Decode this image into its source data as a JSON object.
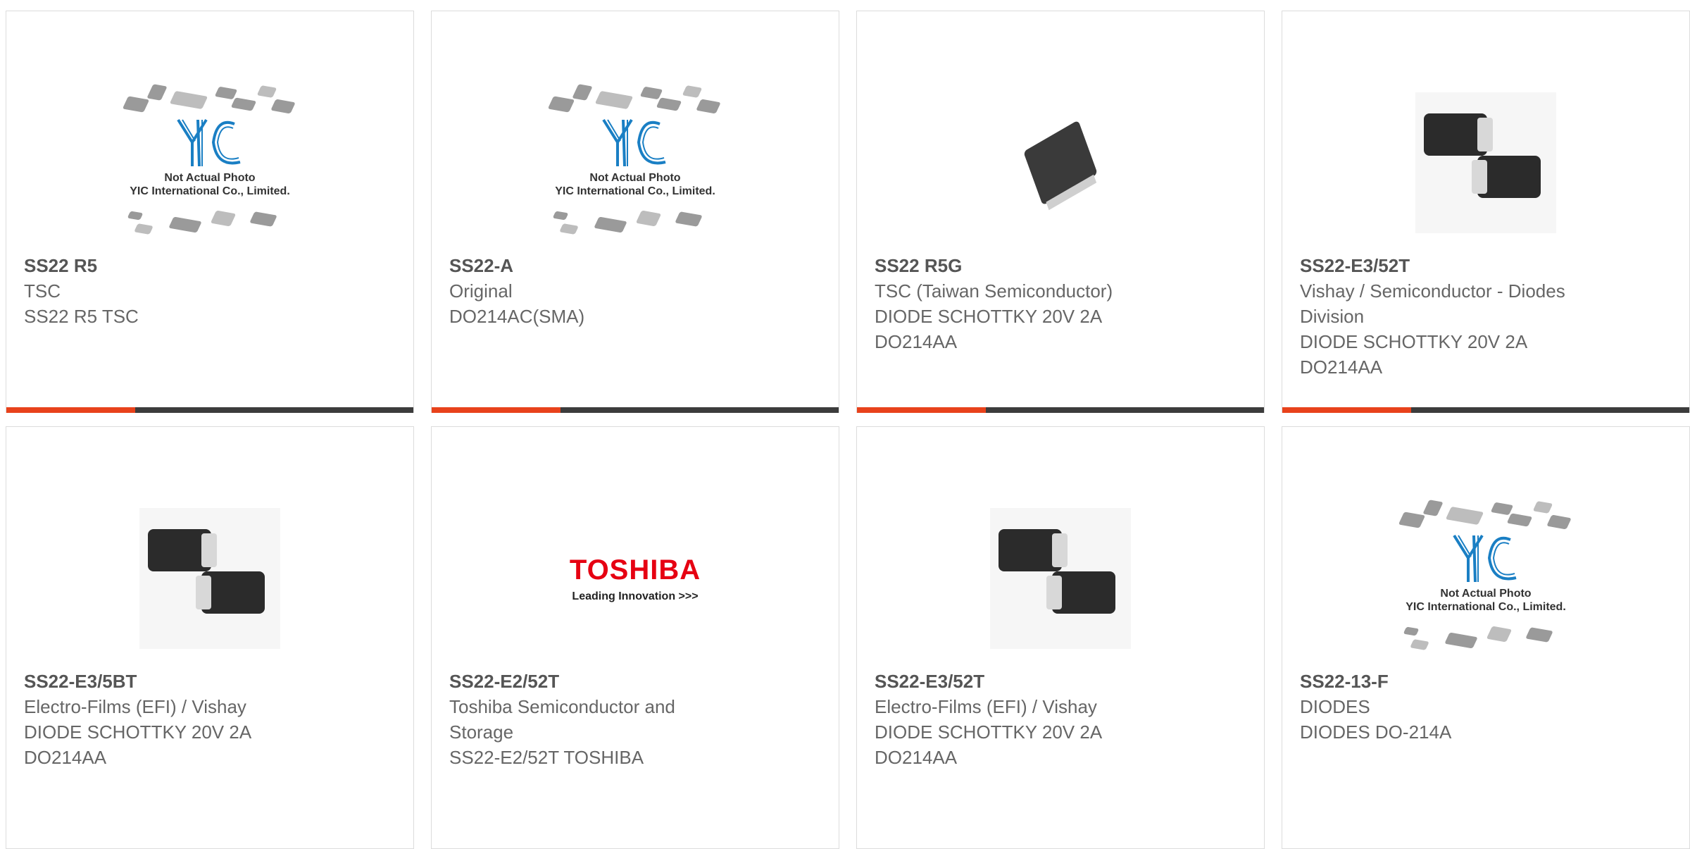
{
  "cards": [
    {
      "pn": "SS22 R5",
      "lines": [
        "TSC",
        "SS22 R5 TSC"
      ],
      "image": "yic-placeholder"
    },
    {
      "pn": "SS22-A",
      "lines": [
        "Original",
        "DO214AC(SMA)"
      ],
      "image": "yic-placeholder"
    },
    {
      "pn": "SS22 R5G",
      "lines": [
        "TSC (Taiwan Semiconductor)",
        "DIODE SCHOTTKY 20V 2A",
        "DO214AA"
      ],
      "image": "single-diode"
    },
    {
      "pn": "SS22-E3/52T",
      "lines": [
        "Vishay / Semiconductor - Diodes",
        "Division",
        "DIODE SCHOTTKY 20V 2A",
        "DO214AA"
      ],
      "image": "sma-pair"
    },
    {
      "pn": "SS22-E3/5BT",
      "lines": [
        "Electro-Films (EFI) / Vishay",
        "DIODE SCHOTTKY 20V 2A",
        "DO214AA"
      ],
      "image": "sma-pair"
    },
    {
      "pn": "SS22-E2/52T",
      "lines": [
        "Toshiba Semiconductor and",
        "Storage",
        "SS22-E2/52T TOSHIBA"
      ],
      "image": "toshiba-logo"
    },
    {
      "pn": "SS22-E3/52T",
      "lines": [
        "Electro-Films (EFI) / Vishay",
        "DIODE SCHOTTKY 20V 2A",
        "DO214AA"
      ],
      "image": "sma-pair"
    },
    {
      "pn": "SS22-13-F",
      "lines": [
        "DIODES",
        "DIODES DO-214A"
      ],
      "image": "yic-placeholder"
    }
  ],
  "placeholder": {
    "line1": "Not Actual Photo",
    "line2": "YIC International Co., Limited."
  },
  "toshiba": {
    "name": "TOSHIBA",
    "tagline": "Leading Innovation >>>"
  },
  "colors": {
    "accent": "#e8421b",
    "bar": "#3c3c3c",
    "yic_blue": "#1a7fc4",
    "toshiba_red": "#e60012"
  }
}
